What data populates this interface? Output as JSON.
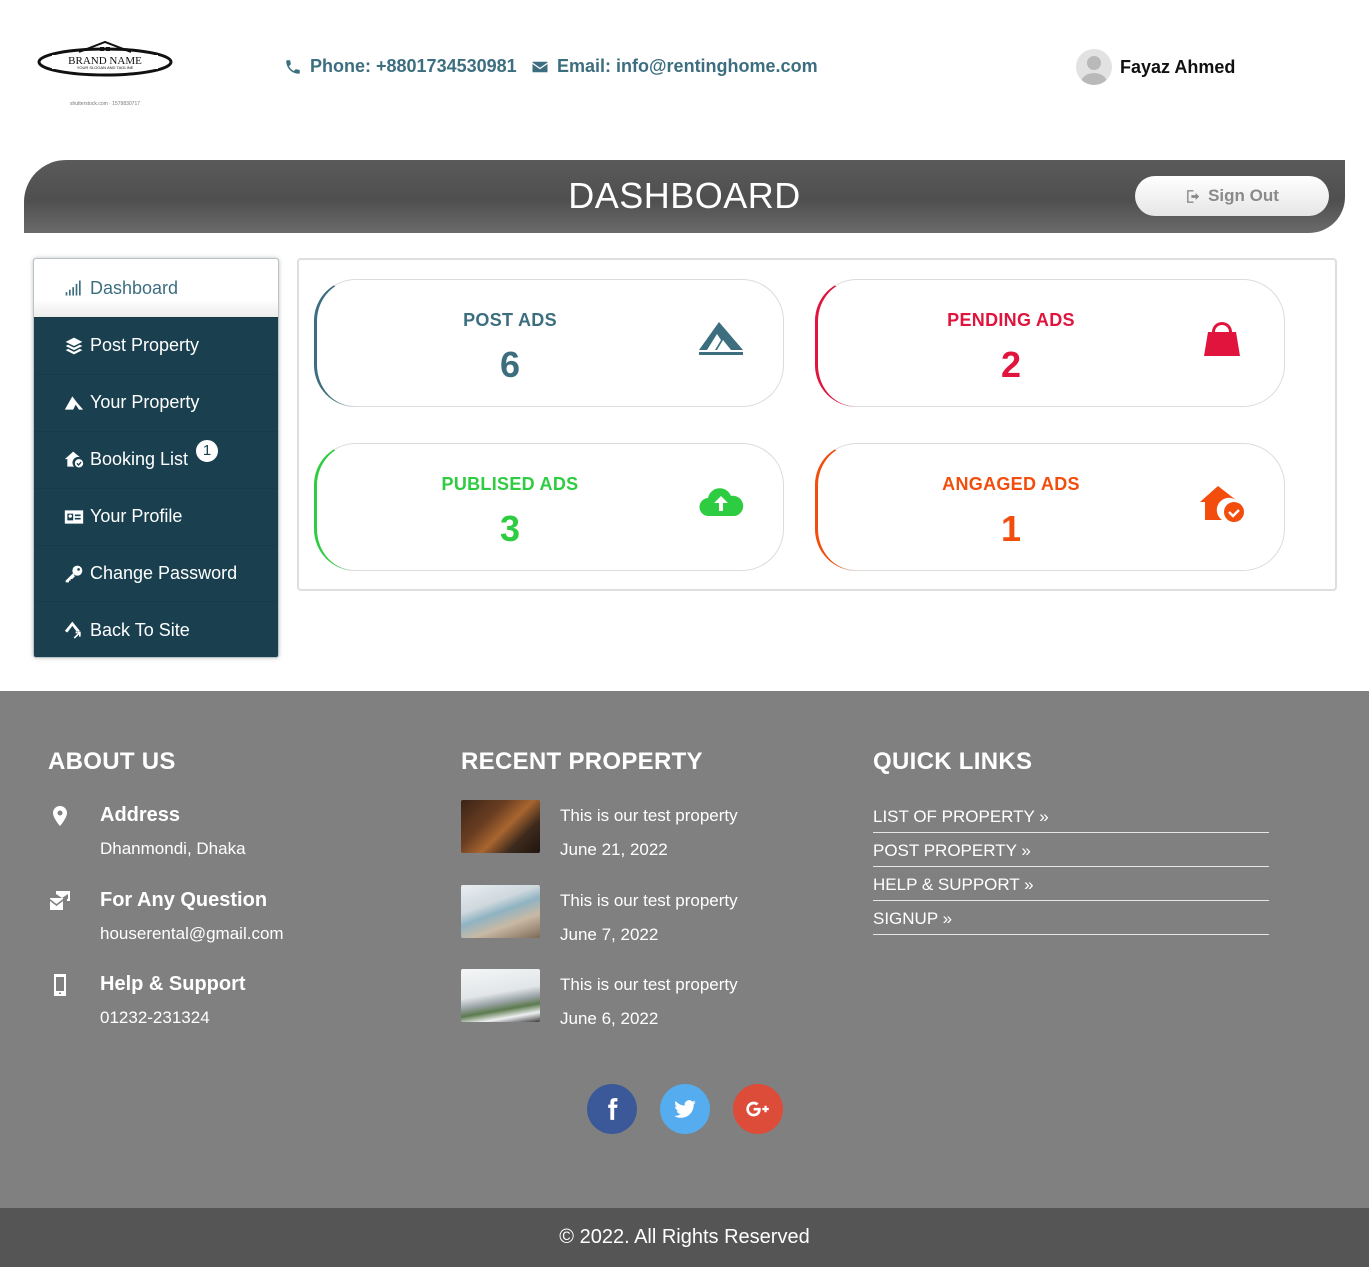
{
  "header": {
    "logo_text": "BRAND NAME",
    "logo_tagline": "YOUR SLOGAN AND TAGLINE",
    "logo_watermark": "shutterstock.com · 1579830717",
    "phone": "Phone: +8801734530981",
    "email": "Email: info@rentinghome.com",
    "user_name": "Fayaz Ahmed"
  },
  "banner": {
    "title": "DASHBOARD",
    "signout_label": "Sign Out"
  },
  "sidebar": {
    "items": [
      {
        "label": "Dashboard",
        "icon": "signal-bars-icon"
      },
      {
        "label": "Post Property",
        "icon": "layers-icon"
      },
      {
        "label": "Your Property",
        "icon": "property-icon"
      },
      {
        "label": "Booking List",
        "icon": "house-check-icon",
        "badge": "1"
      },
      {
        "label": "Your Profile",
        "icon": "id-card-icon"
      },
      {
        "label": "Change Password",
        "icon": "key-icon"
      },
      {
        "label": "Back To Site",
        "icon": "back-arrow-icon"
      }
    ]
  },
  "stats": [
    {
      "label": "POST ADS",
      "value": "6",
      "color": "#3c6e7f",
      "icon": "property-icon"
    },
    {
      "label": "PENDING ADS",
      "value": "2",
      "color": "#e0143c",
      "icon": "shopping-bag-icon"
    },
    {
      "label": "PUBLISED ADS",
      "value": "3",
      "color": "#2ecc40",
      "icon": "cloud-upload-icon"
    },
    {
      "label": "ANGAGED ADS",
      "value": "1",
      "color": "#f24d0c",
      "icon": "house-check-icon"
    }
  ],
  "footer": {
    "about_heading": "ABOUT US",
    "recent_heading": "RECENT PROPERTY",
    "links_heading": "QUICK LINKS",
    "about": [
      {
        "title": "Address",
        "text": "Dhanmondi, Dhaka",
        "icon": "map-pin-icon"
      },
      {
        "title": "For Any Question",
        "text": "houserental@gmail.com",
        "icon": "mail-question-icon"
      },
      {
        "title": "Help & Support",
        "text": "01232-231324",
        "icon": "mobile-phone-icon"
      }
    ],
    "recent": [
      {
        "title": "This is our test property",
        "date": "June 21, 2022"
      },
      {
        "title": "This is our test property",
        "date": "June 7, 2022"
      },
      {
        "title": "This is our test property",
        "date": "June 6, 2022"
      }
    ],
    "links": [
      "LIST OF PROPERTY »",
      "POST PROPERTY »",
      "HELP & SUPPORT »",
      "SIGNUP »"
    ],
    "social": [
      {
        "name": "facebook",
        "color": "#3b5998"
      },
      {
        "name": "twitter",
        "color": "#55acee"
      },
      {
        "name": "google-plus",
        "color": "#dd4b39"
      }
    ],
    "copyright": "© 2022. All Rights Reserved"
  }
}
